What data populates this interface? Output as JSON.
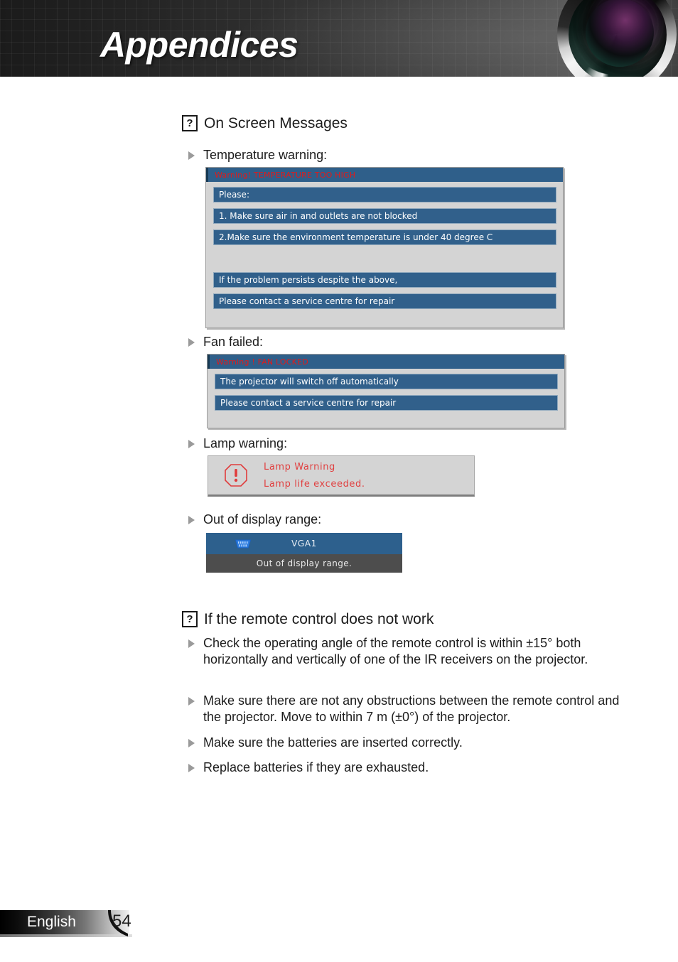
{
  "header": {
    "title": "Appendices",
    "lens_graphic": "camera-lens"
  },
  "sections": [
    {
      "id": "on-screen-messages",
      "icon": "question-mark-icon",
      "icon_glyph": "?",
      "heading": "On Screen Messages",
      "items": [
        {
          "label": "Temperature warning:"
        },
        {
          "label": "Fan failed:"
        },
        {
          "label": "Lamp warning:"
        },
        {
          "label": "Out of display range:"
        }
      ]
    },
    {
      "id": "remote-control-does-not-work",
      "icon": "question-mark-icon",
      "icon_glyph": "?",
      "heading": "If the remote control does not work",
      "items": [
        {
          "label": "Check the operating angle of the remote control is within ±15° both horizontally and vertically of one of the IR receivers on the projector."
        },
        {
          "label": "Make sure there are not any obstructions between the remote control and the projector. Move to within 7 m (±0°) of the projector."
        },
        {
          "label": "Make sure the batteries are inserted correctly."
        },
        {
          "label": "Replace batteries if they are exhausted."
        }
      ]
    }
  ],
  "dialogs": {
    "temperature": {
      "title": "Warning! TEMPERATURE TOO HIGH",
      "rows": [
        "Please:",
        "1. Make sure air in and outlets are not blocked",
        "2.Make sure the environment temperature is under 40 degree C",
        "",
        "If the problem persists despite the above,",
        "Please contact a service centre for repair"
      ]
    },
    "fan": {
      "title": "Warning ! FAN LOCKED",
      "rows": [
        "The projector will switch off automatically",
        "Please contact a service centre for repair"
      ]
    },
    "lamp": {
      "icon": "warning-exclamation-icon",
      "line1": "Lamp Warning",
      "line2": "Lamp life exceeded."
    },
    "range": {
      "source_icon": "vga-connector-icon",
      "source_label": "VGA1",
      "message": "Out of display range."
    }
  },
  "footer": {
    "language": "English",
    "page_number": "54"
  },
  "colors": {
    "osd_title_bar": "#2f5f8a",
    "osd_row": "#31608b",
    "osd_body": "#d4d4d4",
    "warning_red": "#e01b1b",
    "lamp_red": "#e04040",
    "range_top": "#2d608d",
    "range_bottom": "#4d4d4d"
  }
}
